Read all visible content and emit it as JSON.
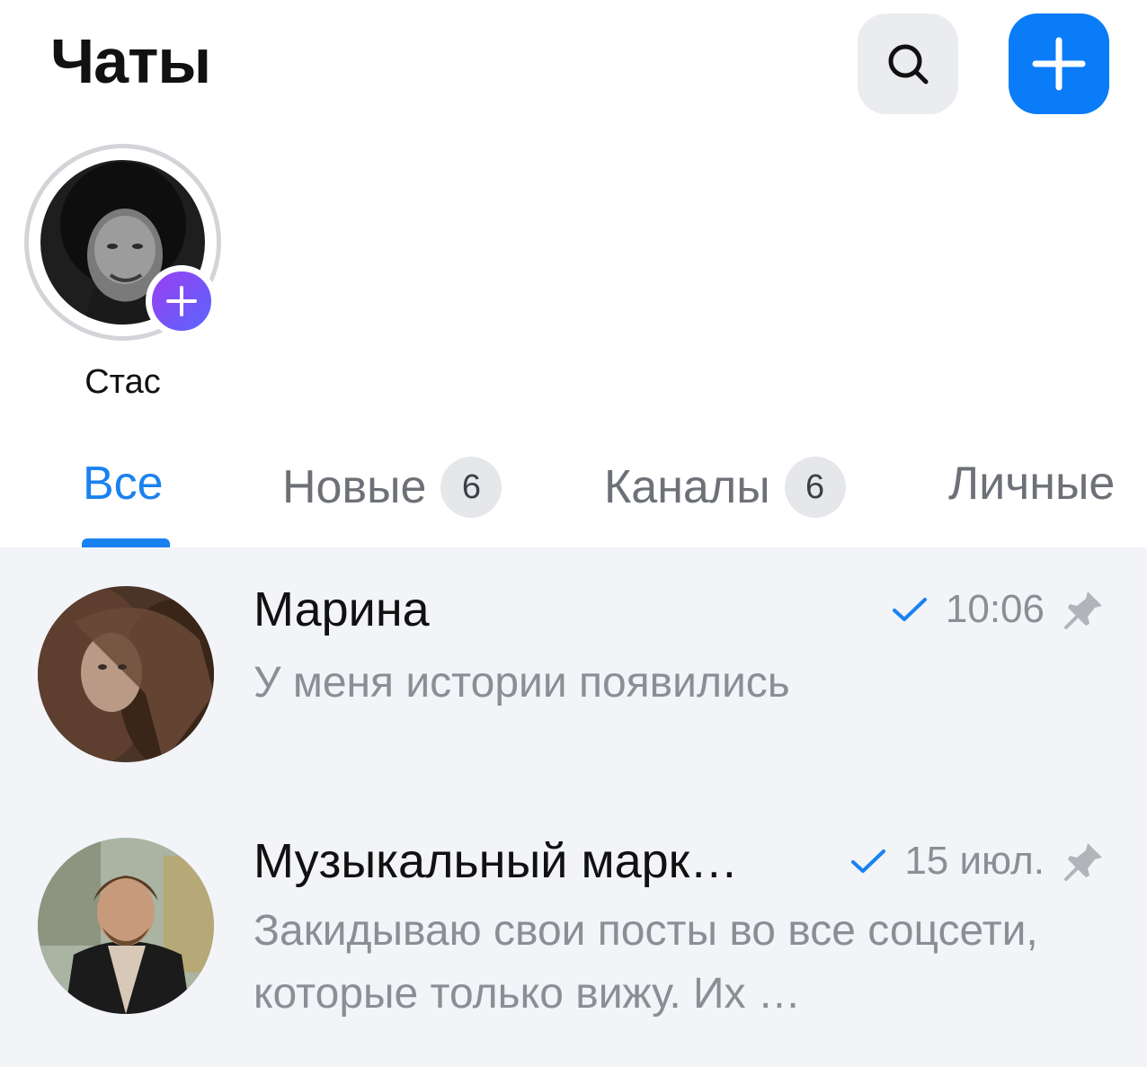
{
  "header": {
    "title": "Чаты",
    "search_icon": "search-icon",
    "new_icon": "plus-icon",
    "accent_color": "#0b7cf7"
  },
  "stories": [
    {
      "name": "Стас",
      "add_icon": "plus-icon"
    }
  ],
  "tabs": [
    {
      "label": "Все",
      "active": true
    },
    {
      "label": "Новые",
      "badge": "6"
    },
    {
      "label": "Каналы",
      "badge": "6"
    },
    {
      "label": "Личные"
    }
  ],
  "chats": [
    {
      "name": "Марина",
      "time": "10:06",
      "read_icon": "check-icon",
      "pinned_icon": "pin-icon",
      "preview": "У меня истории появились"
    },
    {
      "name": "Музыкальный марк…",
      "time": "15 июл.",
      "read_icon": "check-icon",
      "pinned_icon": "pin-icon",
      "preview": "Закидываю свои посты во все соцсети, которые только вижу. Их …"
    }
  ]
}
